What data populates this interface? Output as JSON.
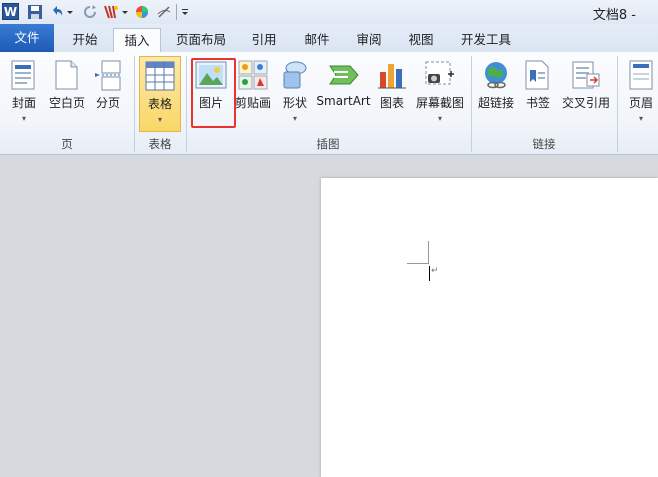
{
  "window": {
    "title": "文档8 -"
  },
  "qat": {
    "app_icon": "W"
  },
  "tabs": [
    {
      "label": "文件"
    },
    {
      "label": "开始"
    },
    {
      "label": "插入"
    },
    {
      "label": "页面布局"
    },
    {
      "label": "引用"
    },
    {
      "label": "邮件"
    },
    {
      "label": "审阅"
    },
    {
      "label": "视图"
    },
    {
      "label": "开发工具"
    }
  ],
  "ribbon": {
    "buttons": {
      "cover": "封面",
      "blank": "空白页",
      "pagebreak": "分页",
      "table": "表格",
      "picture": "图片",
      "clipart": "剪贴画",
      "shapes": "形状",
      "smartart": "SmartArt",
      "chart": "图表",
      "screenshot": "屏幕截图",
      "hyperlink": "超链接",
      "bookmark": "书签",
      "crossref": "交叉引用",
      "header": "页眉"
    },
    "groups": {
      "pages": "页",
      "tables": "表格",
      "illustrations": "插图",
      "links": "链接"
    }
  },
  "document": {
    "para_mark": "↵"
  },
  "colors": {
    "file_tab": "#2a63bf",
    "highlight": "#f9d768",
    "callout": "#e8342f"
  }
}
